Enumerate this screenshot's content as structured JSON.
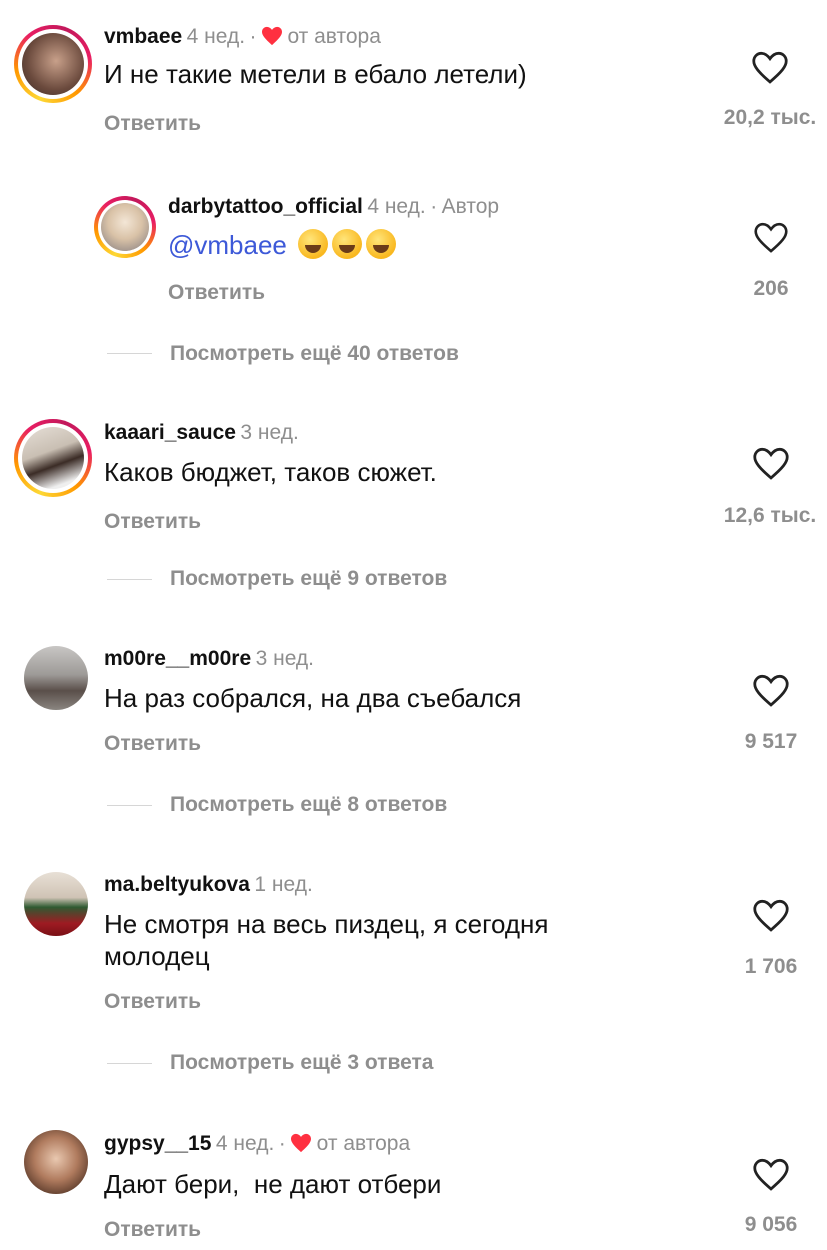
{
  "comments": [
    {
      "username": "vmbaee",
      "time": "4 нед.",
      "badge": "от автора",
      "text": "И не такие метели в ебало летели)",
      "reply": "Ответить",
      "likes": "20,2 тыс."
    },
    {
      "username": "darbytattoo_official",
      "time": "4 нед.",
      "badge": "Автор",
      "mention": "@vmbaee",
      "reply": "Ответить",
      "likes": "206"
    },
    {
      "username": "kaaari_sauce",
      "time": "3 нед.",
      "text": "Каков бюджет, таков сюжет.",
      "reply": "Ответить",
      "likes": "12,6 тыс.",
      "more": "Посмотреть ещё 9 ответов"
    },
    {
      "username": "m00re__m00re",
      "time": "3 нед.",
      "text": "На раз собрался, на два съебался",
      "reply": "Ответить",
      "likes": "9 517",
      "more": "Посмотреть ещё 8 ответов"
    },
    {
      "username": "ma.beltyukova",
      "time": "1 нед.",
      "text_line1": "Не смотря на весь пиздец, я сегодня",
      "text_line2": "молодец",
      "reply": "Ответить",
      "likes": "1 706",
      "more": "Посмотреть ещё 3 ответа"
    },
    {
      "username": "gypsy__15",
      "time": "4 нед.",
      "badge": "от автора",
      "text": "Дают бери,  не дают отбери",
      "reply": "Ответить",
      "likes": "9 056"
    }
  ],
  "thread1_more": "Посмотреть ещё 40 ответов",
  "separator": "·",
  "icons": {
    "like": "heart-outline-icon",
    "author_like": "heart-filled-icon"
  },
  "colors": {
    "heart_red": "#ff3040",
    "mention": "#3d59d8",
    "muted": "#8e8e8e"
  }
}
